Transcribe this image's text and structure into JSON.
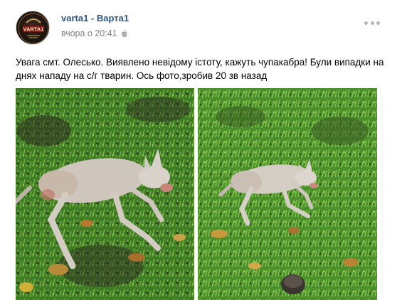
{
  "post": {
    "author": "varta1 - Варта1",
    "time": "вчора о 20:41",
    "avatar_text": "VARTA1",
    "text": "Увага смт. Олесько. Виявлено невідому істоту, кажуть чупакабра! Були випадки на днях нападу на с/г тварин. Ось фото,зробив 20 зв назад"
  },
  "icons": {
    "platform": "apple-icon",
    "menu": "more-dots-icon"
  },
  "colors": {
    "author_link": "#2a5885",
    "meta_text": "#828282",
    "grass": "#4f8a2c",
    "animal": "#cfc7bd"
  }
}
